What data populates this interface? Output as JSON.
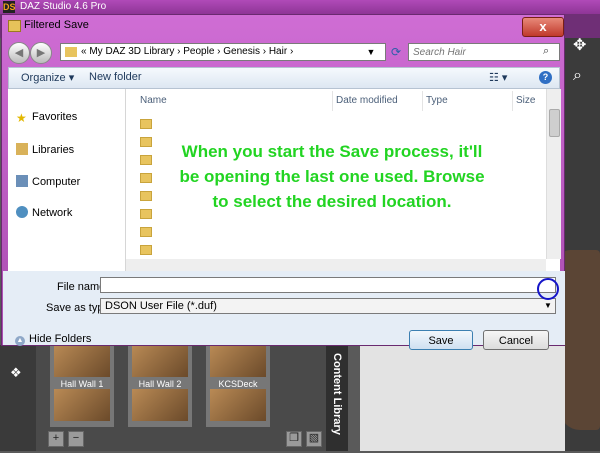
{
  "app": {
    "title": "DAZ Studio 4.6 Pro",
    "logo": "DS"
  },
  "dialog": {
    "title": "Filtered Save",
    "close_label": "x",
    "breadcrumb": "« My DAZ 3D Library › People › Genesis › Hair ›",
    "search_placeholder": "Search Hair",
    "toolbar": {
      "organize": "Organize ▾",
      "new_folder": "New folder",
      "view": "☷ ▾",
      "help": "?"
    },
    "nav": {
      "favorites": "Favorites",
      "libraries": "Libraries",
      "computer": "Computer",
      "network": "Network"
    },
    "columns": {
      "name": "Name",
      "date_modified": "Date modified",
      "type": "Type",
      "size": "Size"
    },
    "annotation": "When you start the Save process, it'll be opening the last one used. Browse to select the desired location.",
    "file_name_label": "File name:",
    "file_name_value": "",
    "save_type_label": "Save as type:",
    "save_type_value": "DSON User File (*.duf)",
    "hide_folders": "Hide Folders",
    "save_button": "Save",
    "cancel_button": "Cancel"
  },
  "library": {
    "items": [
      "Hall Wall 1",
      "Hall Wall 2",
      "KCSDeck"
    ],
    "tab_label": "Content Library"
  },
  "colors": {
    "annotation": "#22d422",
    "highlight": "#1515c8",
    "titlebar": "#b04ab8"
  }
}
